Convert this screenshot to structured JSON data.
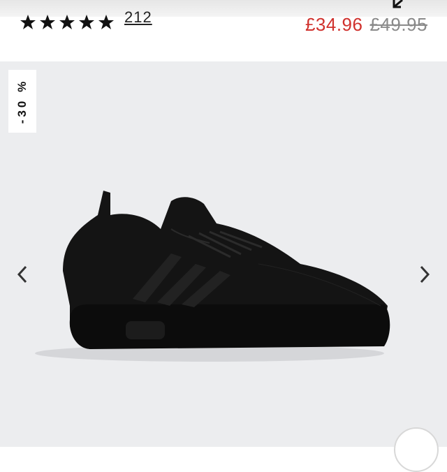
{
  "product": {
    "rating": {
      "stars": 5,
      "review_count": "212"
    },
    "price": {
      "sale": "£34.96",
      "original": "£49.95"
    }
  },
  "gallery": {
    "discount_badge": "-30 %",
    "image_alt": "Black adidas X_PLR sneaker",
    "prev_icon": "chevron-left-icon",
    "next_icon": "chevron-right-icon"
  },
  "colors": {
    "sale_price": "#d0312d",
    "original_price": "#8a8a8a",
    "gallery_background": "#ecedef"
  }
}
